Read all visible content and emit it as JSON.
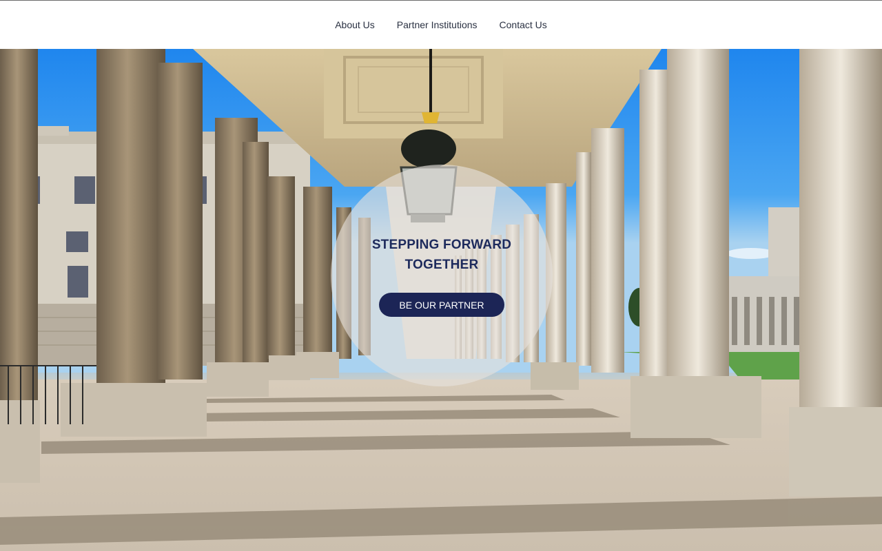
{
  "nav": {
    "items": [
      {
        "label": "About Us"
      },
      {
        "label": "Partner Institutions"
      },
      {
        "label": "Contact Us"
      }
    ]
  },
  "hero": {
    "title": "STEPPING FORWARD TOGETHER",
    "cta_label": "BE OUR PARTNER",
    "image": "colonnade-photo"
  },
  "colors": {
    "nav_text": "#2a3142",
    "title": "#1d2a5c",
    "button_bg": "#1c2556",
    "button_text": "#ffffff"
  }
}
